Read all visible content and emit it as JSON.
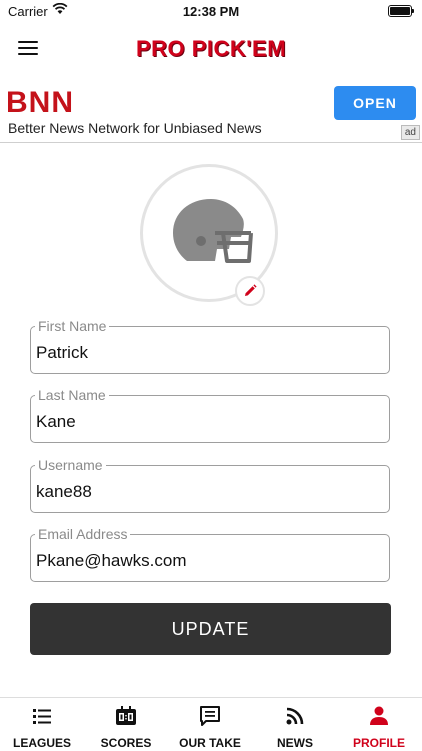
{
  "status_bar": {
    "carrier": "Carrier",
    "time": "12:38 PM"
  },
  "header": {
    "title": "PRO PICK'EM",
    "menu_icon": "hamburger-menu-icon"
  },
  "ad": {
    "logo": "BNN",
    "tagline": "Better News Network for Unbiased News",
    "open_label": "OPEN",
    "tag": "ad",
    "accent_color": "#2d8cf0",
    "brand_color": "#c4121a"
  },
  "profile": {
    "avatar_icon": "football-helmet-icon",
    "edit_icon": "pencil-icon",
    "fields": [
      {
        "label": "First Name",
        "value": "Patrick"
      },
      {
        "label": "Last Name",
        "value": "Kane"
      },
      {
        "label": "Username",
        "value": "kane88"
      },
      {
        "label": "Email Address",
        "value": "Pkane@hawks.com"
      }
    ],
    "update_label": "UPDATE"
  },
  "tabs": [
    {
      "label": "LEAGUES",
      "icon": "list-icon",
      "active": false
    },
    {
      "label": "SCORES",
      "icon": "scoreboard-icon",
      "active": false
    },
    {
      "label": "OUR TAKE",
      "icon": "chat-icon",
      "active": false
    },
    {
      "label": "NEWS",
      "icon": "rss-icon",
      "active": false
    },
    {
      "label": "PROFILE",
      "icon": "person-icon",
      "active": true
    }
  ],
  "colors": {
    "brand_red": "#d0021b",
    "button_dark": "#333333"
  }
}
